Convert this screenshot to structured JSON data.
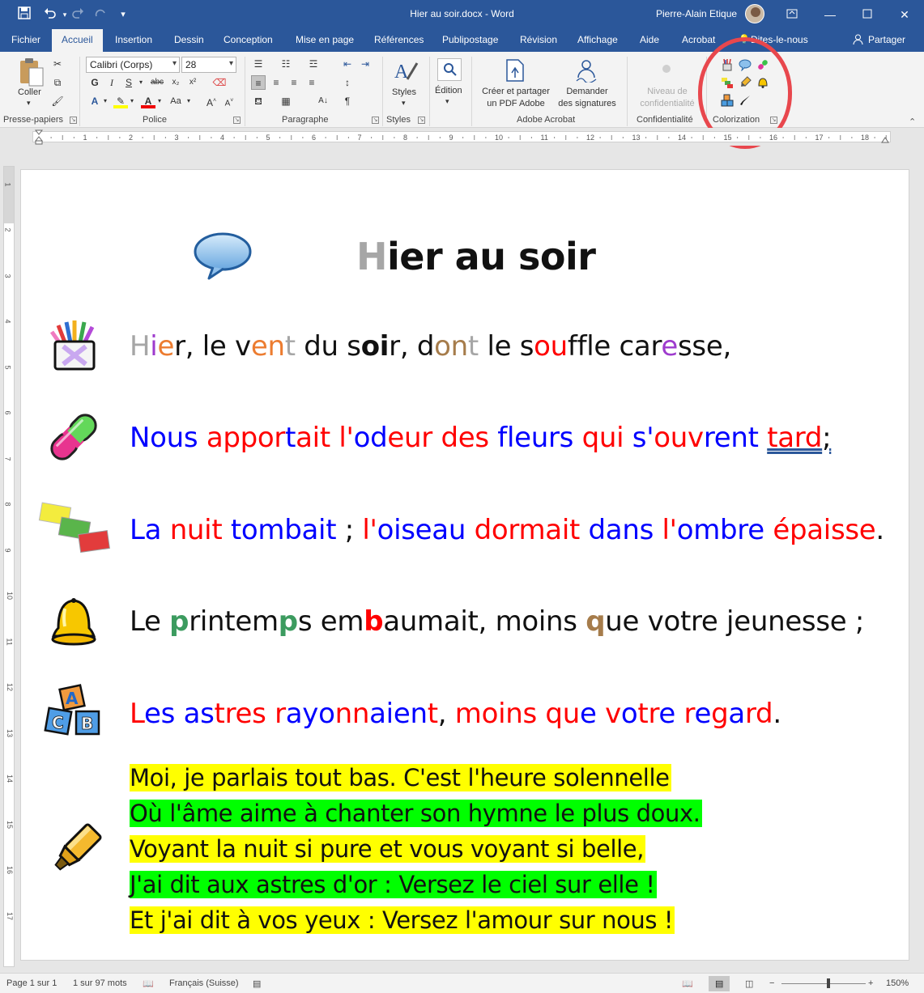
{
  "window": {
    "title": "Hier au soir.docx  -  Word",
    "user": "Pierre-Alain Etique"
  },
  "tabs": [
    "Fichier",
    "Accueil",
    "Insertion",
    "Dessin",
    "Conception",
    "Mise en page",
    "Références",
    "Publipostage",
    "Révision",
    "Affichage",
    "Aide",
    "Acrobat",
    "Dites-le-nous",
    "Partager"
  ],
  "ribbon": {
    "clipboard": {
      "paste": "Coller",
      "label": "Presse-papiers"
    },
    "font": {
      "name": "Calibri (Corps)",
      "size": "28",
      "label": "Police"
    },
    "paragraph": {
      "label": "Paragraphe"
    },
    "styles": {
      "button": "Styles",
      "label": "Styles"
    },
    "editing": {
      "button": "Édition"
    },
    "acrobat": {
      "create_l1": "Créer et partager",
      "create_l2": "un PDF Adobe",
      "sign_l1": "Demander",
      "sign_l2": "des signatures",
      "label": "Adobe Acrobat"
    },
    "confidential": {
      "l1": "Niveau de",
      "l2": "confidentialité",
      "label": "Confidentialité"
    },
    "colorization": {
      "label": "Colorization"
    }
  },
  "document": {
    "title": {
      "first": "H",
      "rest": "ier au soir"
    },
    "lines": {
      "l1": [
        "H",
        "i",
        "e",
        "r, le v",
        "e",
        "n",
        "t",
        " du s",
        "oi",
        "r, d",
        "o",
        "n",
        "t",
        " le s",
        "o",
        "u",
        "ffle car",
        "e",
        "sse,"
      ],
      "l2": [
        "Nous ",
        "app",
        "or",
        "t",
        "ai",
        "t ",
        "l'",
        "o",
        "d",
        "eu",
        "r ",
        "d",
        "es ",
        "fl",
        "eu",
        "rs ",
        "qu",
        "i ",
        "s'",
        "ou",
        "v",
        "r",
        "e",
        "nt ",
        "tard",
        ";"
      ],
      "l3": [
        "La ",
        "nuit ",
        "tombait",
        " ; ",
        "l'",
        "oiseau ",
        "dormait ",
        "dans ",
        "l'",
        "ombre ",
        "épaisse",
        "."
      ],
      "l4": [
        "Le ",
        "p",
        "rintem",
        "p",
        "s em",
        "b",
        "aumait, moins ",
        "q",
        "ue votre jeunesse ;"
      ],
      "l5": [
        "L",
        "es ",
        "as",
        "tr",
        "es ",
        "r",
        "a",
        "y",
        "o",
        "nn",
        "aien",
        "t",
        ", ",
        "m",
        "oi",
        "ns ",
        "qu",
        "e ",
        "v",
        "o",
        "tr",
        "e ",
        "r",
        "e",
        "g",
        "a",
        "rd",
        "."
      ]
    },
    "stanza": [
      "Moi, je parlais tout bas. C'est l'heure solennelle",
      "Où l'âme aime à chanter son hymne le plus doux.",
      "Voyant la nuit si pure et vous voyant si belle,",
      "J'ai dit aux astres d'or : Versez le ciel sur elle !",
      "Et j'ai dit à vos yeux : Versez l'amour sur nous !"
    ]
  },
  "statusbar": {
    "page": "Page 1 sur 1",
    "words": "1 sur 97 mots",
    "language": "Français (Suisse)",
    "zoom": "150%"
  },
  "colors": {
    "blue": "#0000ff",
    "red": "#ff0000",
    "grey": "#a6a6a6",
    "purple": "#9e3bcd",
    "orange": "#ec7c30",
    "green": "#3c9b5f",
    "brown": "#a67c4b",
    "hl_yellow": "#ffff00",
    "hl_green": "#00ff00",
    "word_blue": "#2b579a"
  }
}
